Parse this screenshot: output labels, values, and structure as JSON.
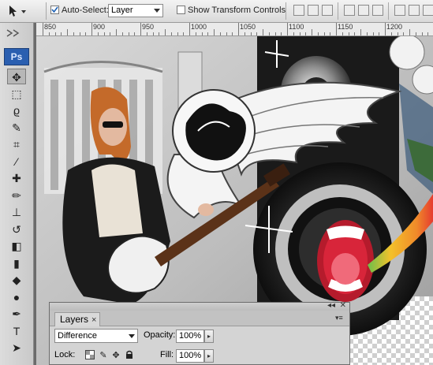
{
  "options_bar": {
    "tool_icon": "move-tool-icon",
    "auto_select_label": "Auto-Select:",
    "auto_select_checked": true,
    "auto_select_value": "Layer",
    "show_transform_label": "Show Transform Controls",
    "show_transform_checked": false
  },
  "ruler": {
    "labels": [
      "850",
      "900",
      "950",
      "1000",
      "1050",
      "1100",
      "1150",
      "1200"
    ]
  },
  "tools": {
    "app_badge": "Ps",
    "items": [
      {
        "name": "move-tool",
        "glyph": "✥",
        "active": true
      },
      {
        "name": "marquee-tool",
        "glyph": "⬚",
        "active": false
      },
      {
        "name": "lasso-tool",
        "glyph": "ϱ",
        "active": false
      },
      {
        "name": "quick-select-tool",
        "glyph": "✎",
        "active": false
      },
      {
        "name": "crop-tool",
        "glyph": "⌗",
        "active": false
      },
      {
        "name": "eyedropper-tool",
        "glyph": "⁄",
        "active": false
      },
      {
        "name": "healing-brush-tool",
        "glyph": "✚",
        "active": false
      },
      {
        "name": "brush-tool",
        "glyph": "✏",
        "active": false
      },
      {
        "name": "clone-stamp-tool",
        "glyph": "⊥",
        "active": false
      },
      {
        "name": "history-brush-tool",
        "glyph": "↺",
        "active": false
      },
      {
        "name": "eraser-tool",
        "glyph": "◧",
        "active": false
      },
      {
        "name": "gradient-tool",
        "glyph": "▮",
        "active": false
      },
      {
        "name": "blur-tool",
        "glyph": "◆",
        "active": false
      },
      {
        "name": "dodge-tool",
        "glyph": "●",
        "active": false
      },
      {
        "name": "pen-tool",
        "glyph": "✒",
        "active": false
      },
      {
        "name": "type-tool",
        "glyph": "T",
        "active": false
      },
      {
        "name": "path-select-tool",
        "glyph": "➤",
        "active": false
      }
    ]
  },
  "layers_panel": {
    "tab_label": "Layers",
    "tab_close": "×",
    "blend_mode": "Difference",
    "opacity_label": "Opacity:",
    "opacity_value": "100%",
    "lock_label": "Lock:",
    "fill_label": "Fill:",
    "fill_value": "100%"
  },
  "colors": {
    "ps_badge": "#2a5fb0",
    "mouth_red": "#d8253a",
    "rainbow": [
      "#e53b2f",
      "#f3c12b",
      "#6cc04a"
    ]
  }
}
